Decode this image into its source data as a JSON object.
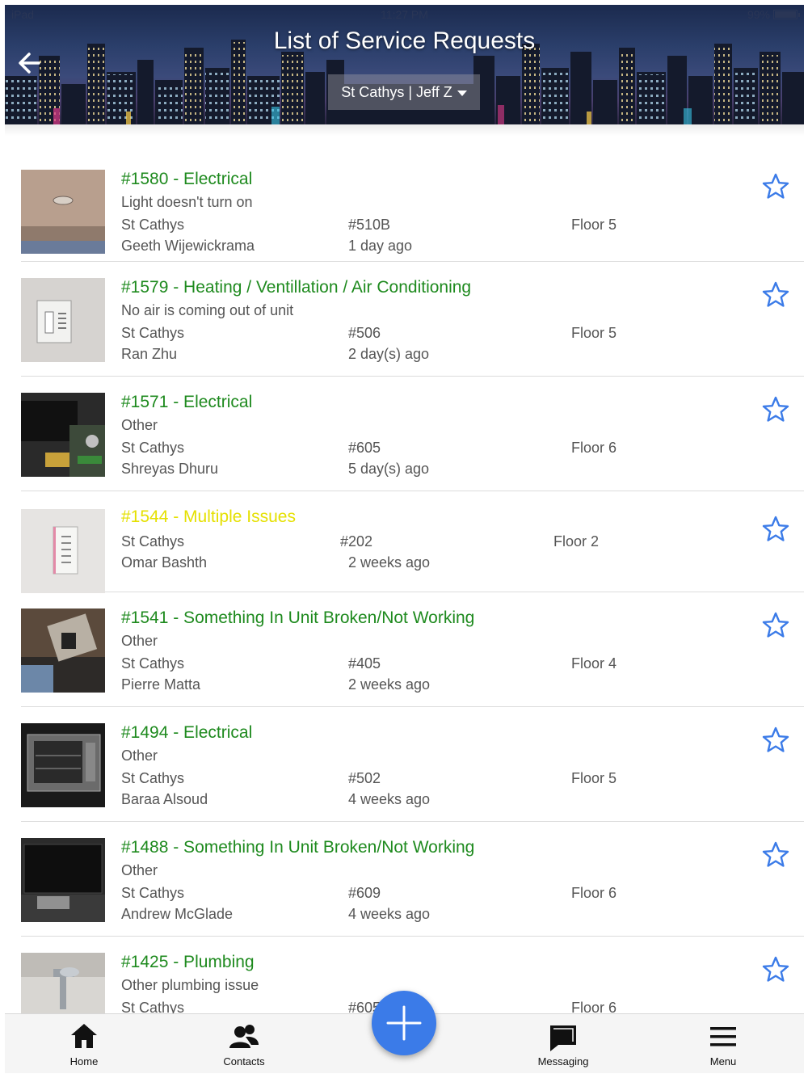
{
  "status_bar": {
    "carrier": "iPad",
    "time": "11:27 PM",
    "battery": "99%",
    "battery_level": 0.99
  },
  "header": {
    "title": "List of Service Requests",
    "org_selector": "St Cathys | Jeff Z"
  },
  "requests": [
    {
      "title": "#1580 - Electrical",
      "description": "Light doesn't turn on",
      "building": "St Cathys",
      "unit": "#510B",
      "floor": "Floor 5",
      "reporter": "Geeth Wijewickrama",
      "age": "1 day ago",
      "title_color": "#1e8a1e"
    },
    {
      "title": "#1579 - Heating / Ventillation / Air Conditioning",
      "description": "No air is coming out of unit",
      "building": "St Cathys",
      "unit": "#506",
      "floor": "Floor 5",
      "reporter": "Ran Zhu",
      "age": "2 day(s) ago",
      "title_color": "#1e8a1e"
    },
    {
      "title": "#1571 - Electrical",
      "description": "Other",
      "building": "St Cathys",
      "unit": "#605",
      "floor": "Floor 6",
      "reporter": "Shreyas Dhuru",
      "age": "5 day(s) ago",
      "title_color": "#1e8a1e"
    },
    {
      "title": "#1544 - Multiple Issues",
      "description": "",
      "building": "St Cathys",
      "unit": "#202",
      "floor": "Floor 2",
      "reporter": "Omar Bashth",
      "age": "2 weeks ago",
      "title_color": "#e5e000"
    },
    {
      "title": "#1541 - Something In Unit Broken/Not Working",
      "description": "Other",
      "building": "St Cathys",
      "unit": "#405",
      "floor": "Floor 4",
      "reporter": "Pierre Matta",
      "age": "2 weeks ago",
      "title_color": "#1e8a1e"
    },
    {
      "title": "#1494 - Electrical",
      "description": "Other",
      "building": "St Cathys",
      "unit": "#502",
      "floor": "Floor 5",
      "reporter": "Baraa Alsoud",
      "age": "4 weeks ago",
      "title_color": "#1e8a1e"
    },
    {
      "title": "#1488 - Something In Unit Broken/Not Working",
      "description": "Other",
      "building": "St Cathys",
      "unit": "#609",
      "floor": "Floor 6",
      "reporter": "Andrew McGlade",
      "age": "4 weeks ago",
      "title_color": "#1e8a1e"
    },
    {
      "title": "#1425 - Plumbing",
      "description": "Other plumbing issue",
      "building": "St Cathys",
      "unit": "#605",
      "floor": "Floor 6",
      "reporter": "",
      "age": "",
      "title_color": "#1e8a1e"
    }
  ],
  "nav": {
    "home": "Home",
    "contacts": "Contacts",
    "messaging": "Messaging",
    "menu": "Menu",
    "add_icon": "plus-icon"
  },
  "colors": {
    "accent": "#3b7be8",
    "title_green": "#1e8a1e",
    "title_yellow": "#e5e000",
    "star_blue": "#3b7be8"
  }
}
